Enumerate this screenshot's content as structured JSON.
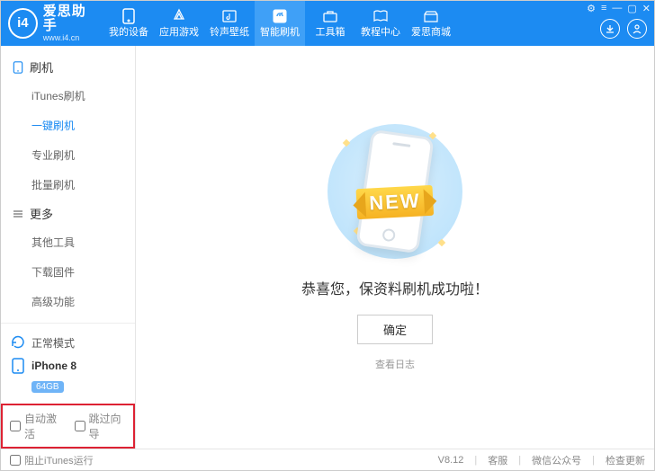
{
  "header": {
    "logo_text": "i4",
    "brand": "爱思助手",
    "url": "www.i4.cn"
  },
  "nav": [
    {
      "label": "我的设备",
      "icon": "device"
    },
    {
      "label": "应用游戏",
      "icon": "apps"
    },
    {
      "label": "铃声壁纸",
      "icon": "music"
    },
    {
      "label": "智能刷机",
      "icon": "flash",
      "active": true
    },
    {
      "label": "工具箱",
      "icon": "toolbox"
    },
    {
      "label": "教程中心",
      "icon": "book"
    },
    {
      "label": "爱思商城",
      "icon": "store"
    }
  ],
  "sidebar": {
    "sections": [
      {
        "title": "刷机",
        "icon": "device",
        "items": [
          {
            "label": "iTunes刷机"
          },
          {
            "label": "一键刷机",
            "active": true
          },
          {
            "label": "专业刷机"
          },
          {
            "label": "批量刷机"
          }
        ]
      },
      {
        "title": "更多",
        "icon": "more",
        "items": [
          {
            "label": "其他工具"
          },
          {
            "label": "下载固件"
          },
          {
            "label": "高级功能"
          }
        ]
      }
    ],
    "mode_label": "正常模式",
    "device_name": "iPhone 8",
    "device_storage": "64GB",
    "checks": {
      "auto_activate": "自动激活",
      "skip_guide": "跳过向导"
    }
  },
  "main": {
    "ribbon": "NEW",
    "success": "恭喜您，保资料刷机成功啦！",
    "confirm": "确定",
    "view_log": "查看日志"
  },
  "footer": {
    "block_itunes": "阻止iTunes运行",
    "version": "V8.12",
    "links": [
      "客服",
      "微信公众号",
      "检查更新"
    ]
  }
}
